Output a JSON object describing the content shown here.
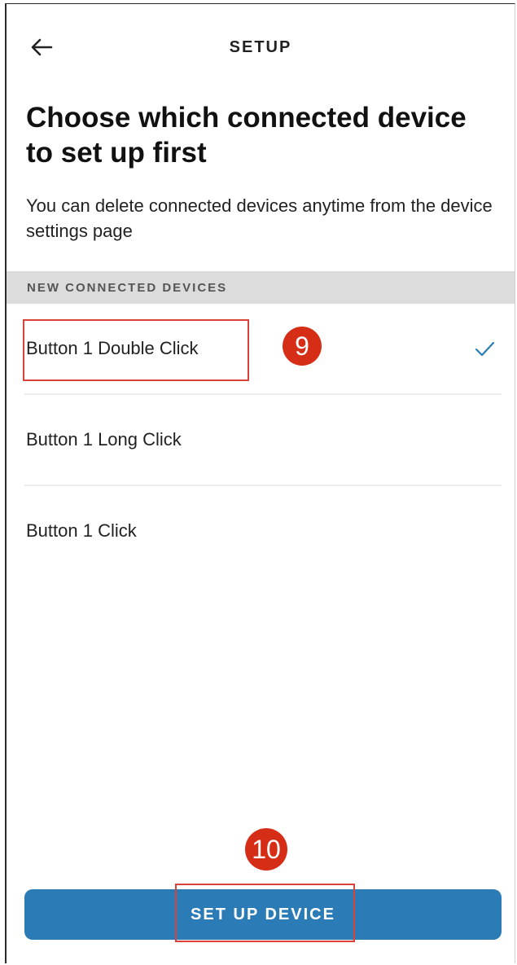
{
  "header": {
    "title": "SETUP",
    "back_icon": "arrow-left-icon"
  },
  "main": {
    "heading": "Choose which connected device to set up first",
    "subtext": "You can delete connected devices anytime from the device settings page"
  },
  "section": {
    "label": "NEW CONNECTED DEVICES"
  },
  "devices": [
    {
      "label": "Button 1 Double Click",
      "selected": true
    },
    {
      "label": "Button 1 Long Click",
      "selected": false
    },
    {
      "label": "Button 1 Click",
      "selected": false
    }
  ],
  "annotations": {
    "step_9": "9",
    "step_10": "10"
  },
  "footer": {
    "setup_button_label": "SET UP DEVICE"
  },
  "colors": {
    "accent": "#2b7cb6",
    "annotation": "#d62e16",
    "section_bg": "#dcdcdc"
  }
}
